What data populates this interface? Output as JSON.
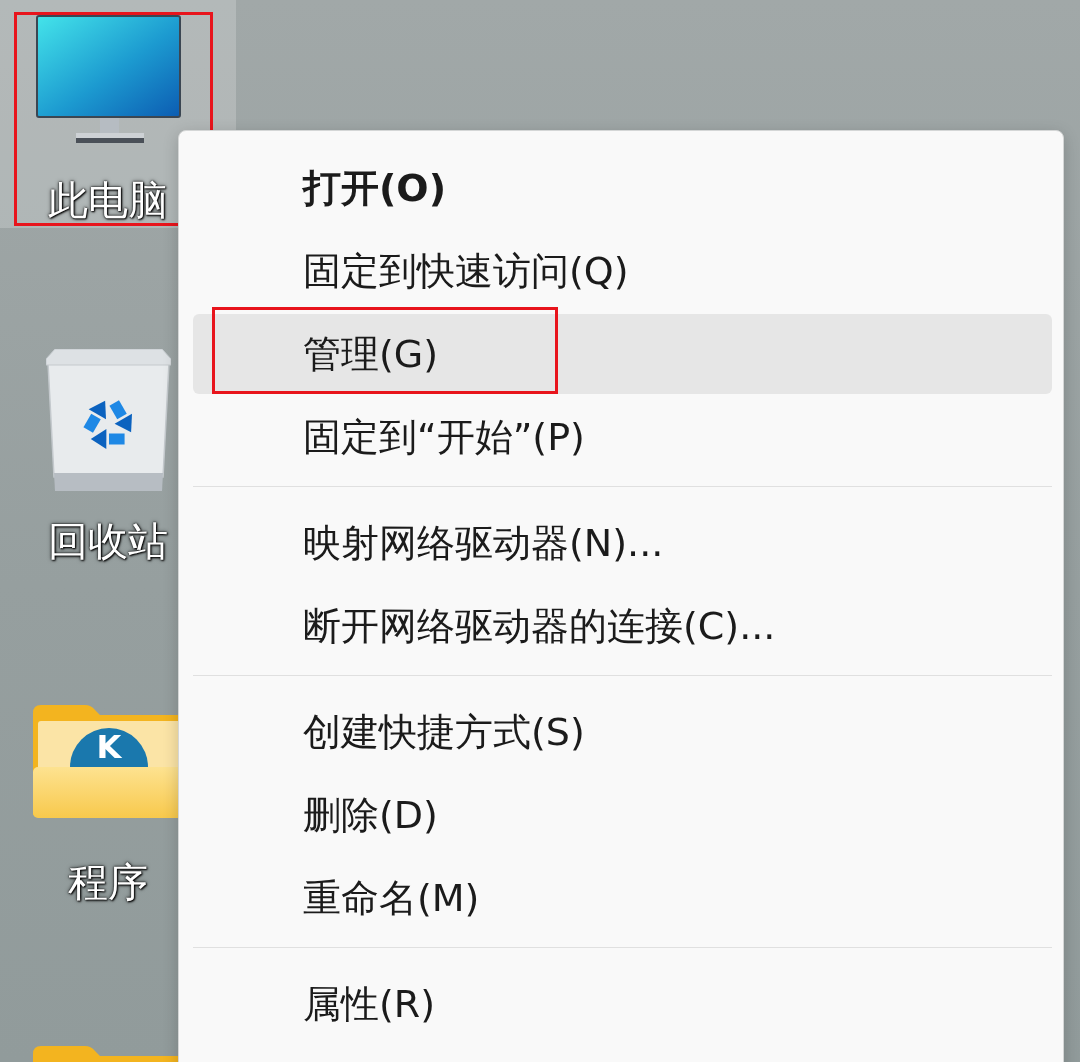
{
  "desktop_icons": [
    {
      "kind": "computer",
      "label": "此电脑",
      "selected": true,
      "annotated": true
    },
    {
      "kind": "recycle_bin",
      "label": "回收站",
      "selected": false,
      "annotated": false
    },
    {
      "kind": "folder",
      "label": "程序",
      "badge": "K",
      "selected": false,
      "annotated": false
    },
    {
      "kind": "folder",
      "selected": false,
      "annotated": false
    }
  ],
  "context_menu": {
    "groups": [
      {
        "items": [
          {
            "label": "打开(O)",
            "default": true,
            "selected": false,
            "annotated": false
          },
          {
            "label": "固定到快速访问(Q)",
            "default": false,
            "selected": false,
            "annotated": false
          },
          {
            "label": "管理(G)",
            "default": false,
            "selected": true,
            "annotated": true
          },
          {
            "label": "固定到“开始”(P)",
            "default": false,
            "selected": false,
            "annotated": false
          }
        ]
      },
      {
        "items": [
          {
            "label": "映射网络驱动器(N)...",
            "default": false,
            "selected": false,
            "annotated": false
          },
          {
            "label": "断开网络驱动器的连接(C)...",
            "default": false,
            "selected": false,
            "annotated": false
          }
        ]
      },
      {
        "items": [
          {
            "label": "创建快捷方式(S)",
            "default": false,
            "selected": false,
            "annotated": false
          },
          {
            "label": "删除(D)",
            "default": false,
            "selected": false,
            "annotated": false
          },
          {
            "label": "重命名(M)",
            "default": false,
            "selected": false,
            "annotated": false
          }
        ]
      },
      {
        "items": [
          {
            "label": "属性(R)",
            "default": false,
            "selected": false,
            "annotated": false
          }
        ]
      }
    ]
  }
}
